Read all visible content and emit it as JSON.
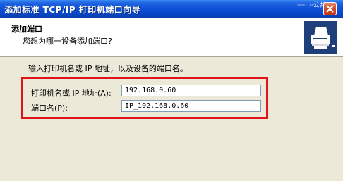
{
  "window": {
    "title": "添加标准 TCP/IP 打印机端口向导",
    "partial_text": "·········公共···"
  },
  "header": {
    "title": "添加端口",
    "subtitle": "您想为哪一设备添加端口?"
  },
  "body": {
    "instruction": "输入打印机名或 IP 地址，以及设备的端口名。",
    "fields": {
      "ip": {
        "label": "打印机名或 IP 地址(A):",
        "value": "192.168.0.60"
      },
      "port": {
        "label": "端口名(P):",
        "value": "IP_192.168.0.60"
      }
    }
  },
  "colors": {
    "titlebar": "#0c4ed6",
    "highlight": "#e0141a",
    "close_button": "#c03a18"
  },
  "icons": {
    "close": "close-icon",
    "printer": "printer-icon"
  }
}
